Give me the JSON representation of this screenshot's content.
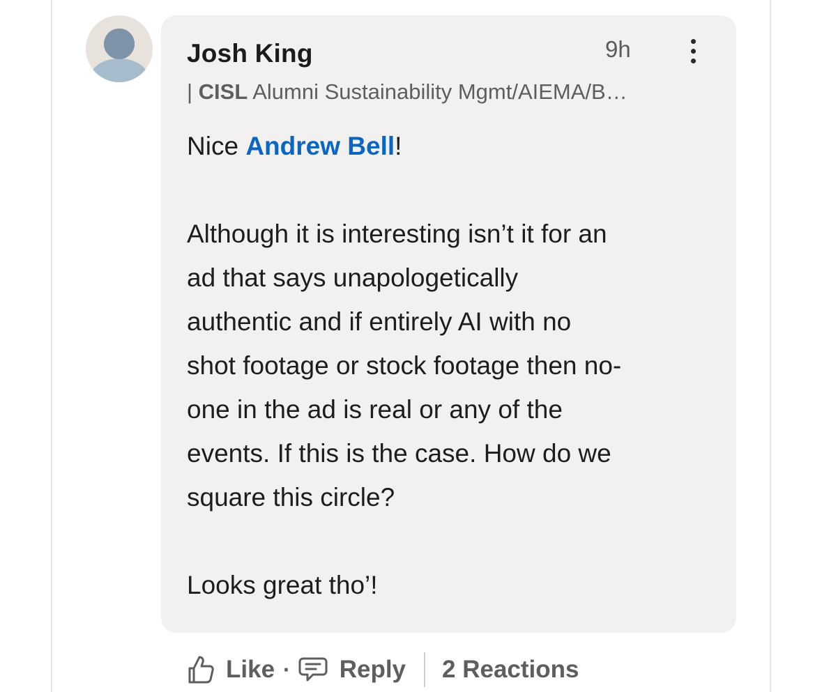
{
  "comment": {
    "author": "Josh King",
    "time": "9h",
    "headline_prefix": "| ",
    "headline_org": "CISL",
    "headline_rest": " Alumni Sustainability Mgmt/AIEMA/B…",
    "greeting_before": "Nice ",
    "mention": "Andrew Bell",
    "greeting_after": "!",
    "paragraph_lines": [
      "Although it is interesting isn’t it for an",
      "ad that says unapologetically",
      "authentic and if entirely AI with no",
      "shot footage or stock footage then no-",
      "one in the ad is real or any of the",
      "events. If this is the case. How do we",
      "square this circle?"
    ],
    "closing": "Looks great tho’!"
  },
  "actions": {
    "like_label": "Like",
    "separator": "·",
    "reply_label": "Reply",
    "reactions_label": "2 Reactions"
  },
  "icons": {
    "avatar": "default-person-avatar",
    "more": "more-vertical-icon",
    "like": "thumbs-up-icon",
    "reply": "speech-bubble-icon"
  },
  "colors": {
    "mention": "#0a66c2",
    "bubble": "#f2f1ef",
    "secondary_text": "#5e5e5e"
  }
}
